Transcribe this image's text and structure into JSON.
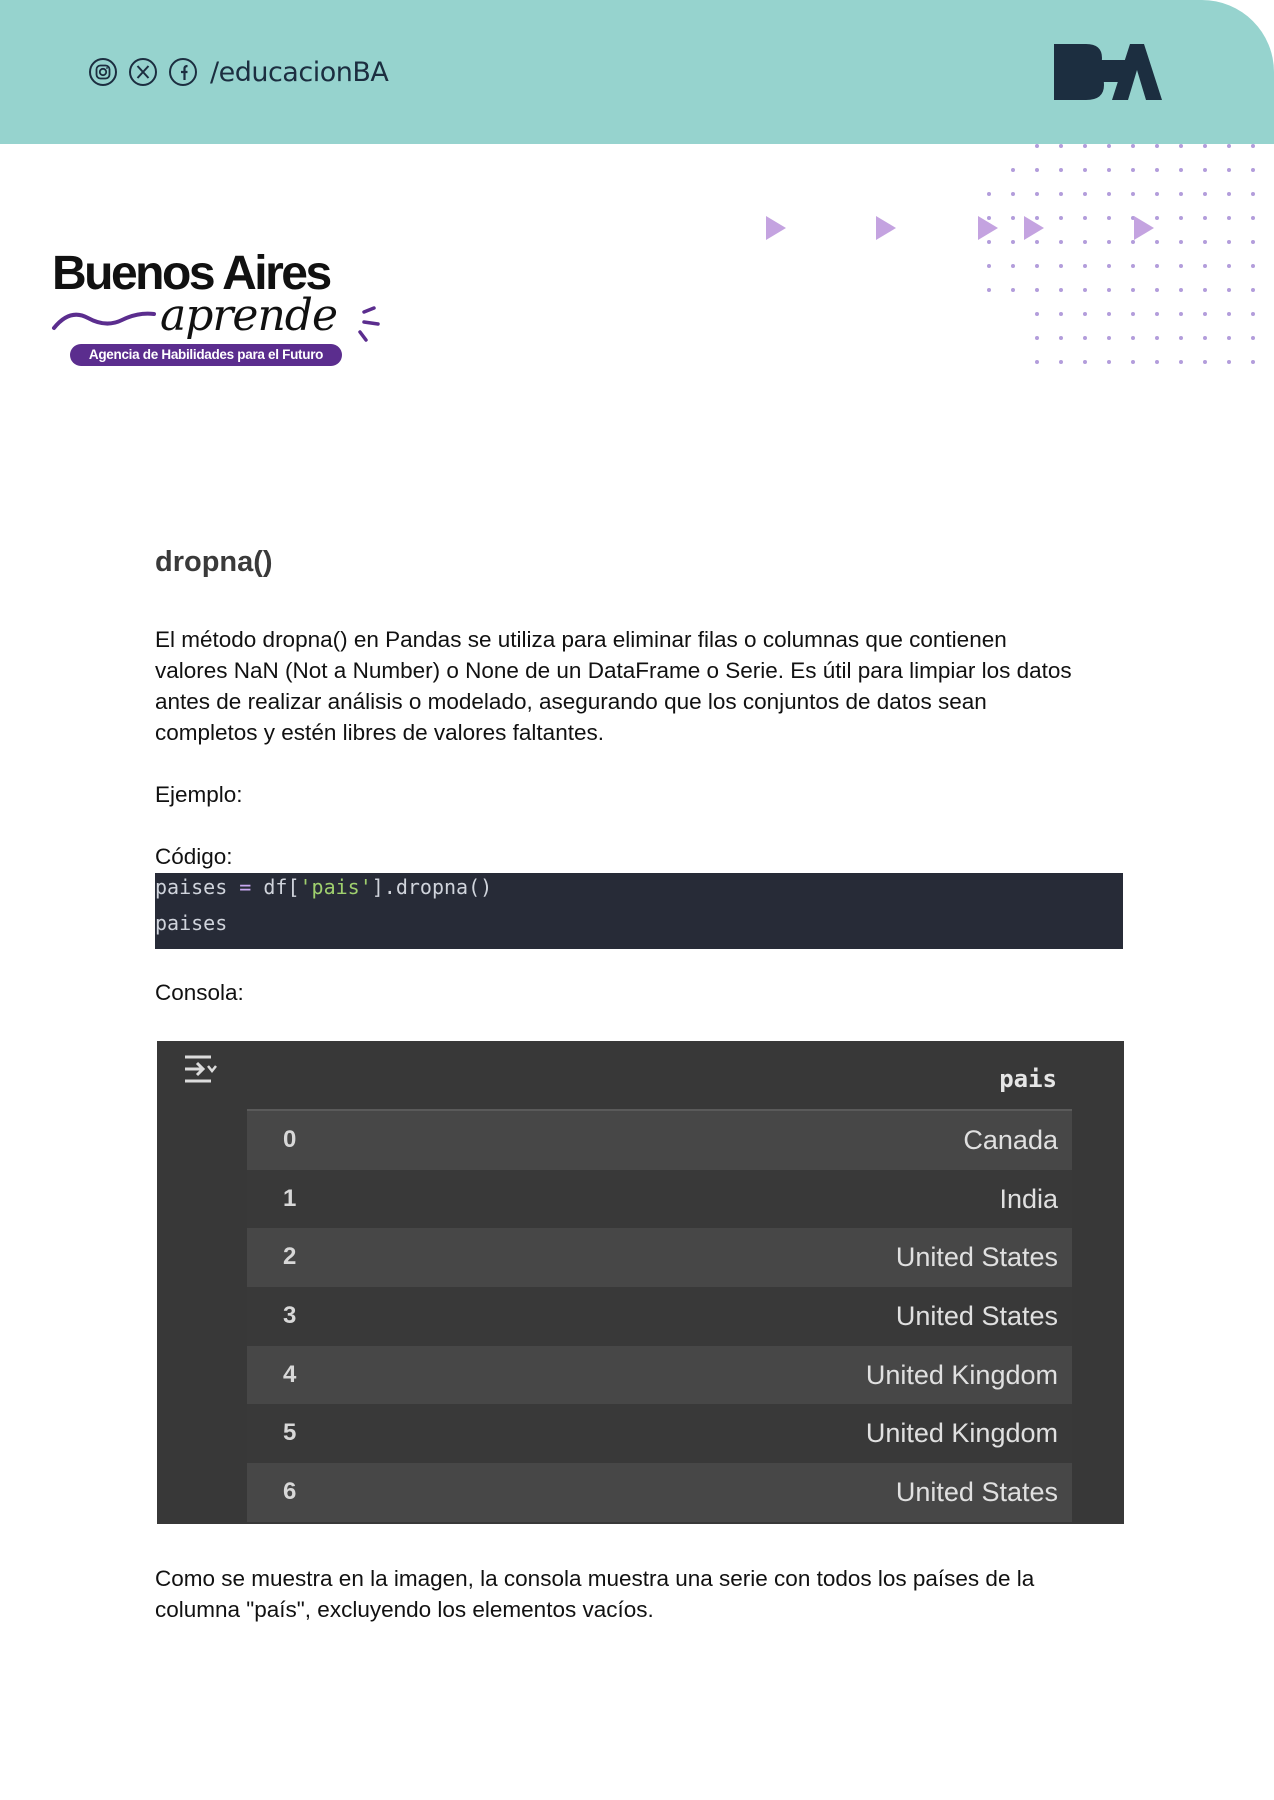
{
  "header": {
    "socials": [
      {
        "icon": "instagram-icon"
      },
      {
        "icon": "x-icon"
      },
      {
        "icon": "facebook-icon"
      }
    ],
    "handle": "/educacionBA",
    "logo_text": "BA",
    "colors": {
      "band": "#96d3ce",
      "logo": "#1c2e40"
    }
  },
  "brand": {
    "title": "Buenos Aires",
    "script": "aprende",
    "tagline": "Agencia de Habilidades para el Futuro",
    "colors": {
      "accent": "#5b2d8e"
    }
  },
  "content": {
    "heading": "dropna()",
    "paragraph_lines": [
      "El método dropna() en Pandas se utiliza para eliminar filas o columnas que contienen",
      "valores NaN (Not a Number) o None de un DataFrame o Serie. Es útil para limpiar los datos",
      "antes de realizar análisis o modelado, asegurando que los conjuntos de datos sean",
      "completos y estén libres de valores faltantes."
    ],
    "example_label": "Ejemplo:",
    "code_label": "Código:",
    "code": {
      "line1": {
        "var": "paises",
        "op": " = ",
        "pre": "df[",
        "str": "'pais'",
        "post": "].dropna()"
      },
      "line2": "paises"
    },
    "console_label": "Consola:",
    "console": {
      "column_header": "pais",
      "rows": [
        {
          "index": "0",
          "value": "Canada"
        },
        {
          "index": "1",
          "value": "India"
        },
        {
          "index": "2",
          "value": "United States"
        },
        {
          "index": "3",
          "value": "United States"
        },
        {
          "index": "4",
          "value": "United Kingdom"
        },
        {
          "index": "5",
          "value": "United Kingdom"
        },
        {
          "index": "6",
          "value": "United States"
        }
      ]
    },
    "closing_lines": [
      "Como se muestra en la imagen, la consola muestra una serie con todos los países de la",
      "columna \"país\", excluyendo los elementos vacíos."
    ]
  }
}
